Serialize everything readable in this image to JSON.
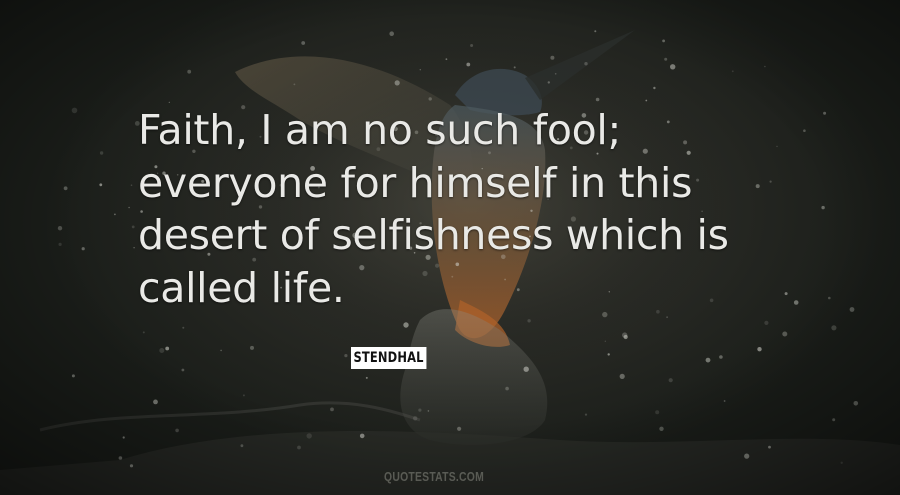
{
  "quote": {
    "lines": [
      "Faith, I am no such fool;",
      "everyone for himself in this",
      "desert of selfishness which is",
      "called life."
    ]
  },
  "author": "STENDHAL",
  "watermark": "QUOTESTATS.COM",
  "background": {
    "subject": "kingfisher-diving-in-water-splash",
    "colors": {
      "dark": "#1a1d19",
      "mid": "#3b3a33",
      "bird_orange": "#b0622a",
      "bird_blue": "#3d4d57"
    }
  },
  "colors": {
    "quote_text": "#e9e9e6",
    "author_bg": "#ffffff",
    "author_text": "#111111"
  }
}
